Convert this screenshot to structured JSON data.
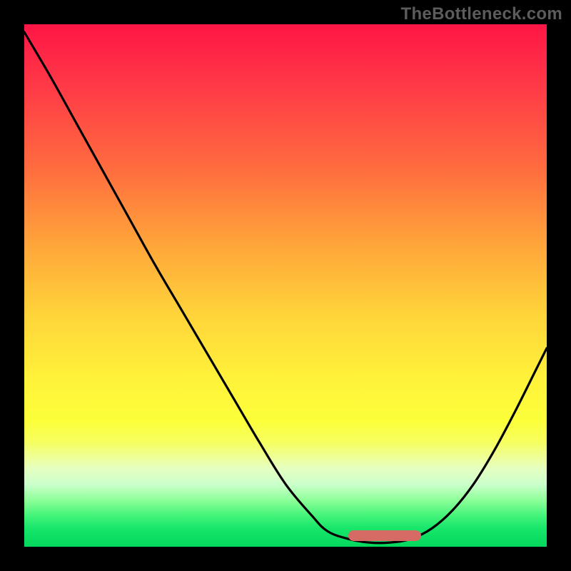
{
  "watermark": "TheBottleneck.com",
  "colors": {
    "frame_bg": "#000000",
    "curve": "#000000",
    "pill": "#d66a64",
    "gradient_top": "#ff1646",
    "gradient_bottom": "#02d85d"
  },
  "chart_data": {
    "type": "line",
    "title": "",
    "xlabel": "",
    "ylabel": "",
    "xlim": [
      0,
      100
    ],
    "ylim": [
      0,
      100
    ],
    "grid": false,
    "series": [
      {
        "name": "bottleneck-curve",
        "x": [
          0,
          5,
          10,
          15,
          20,
          25,
          30,
          35,
          40,
          45,
          50,
          55,
          58,
          62,
          66,
          70,
          74,
          78,
          82,
          86,
          90,
          94,
          98,
          100
        ],
        "values": [
          98.5,
          90,
          81,
          72,
          63,
          54,
          45.5,
          37,
          28.5,
          20,
          12,
          6,
          3,
          1.5,
          0.8,
          0.8,
          1.5,
          3.5,
          7,
          12,
          18.5,
          26,
          34,
          38
        ]
      }
    ],
    "annotations": [
      {
        "kind": "pill",
        "name": "optimum-range-marker",
        "x_start": 62,
        "x_end": 76,
        "y": 2
      }
    ]
  }
}
